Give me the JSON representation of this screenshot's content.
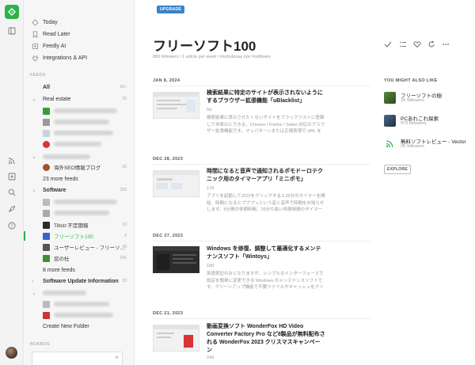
{
  "nav": {
    "top_items": [
      {
        "label": "Today"
      },
      {
        "label": "Read Later"
      },
      {
        "label": "Feedly AI"
      },
      {
        "label": "Integrations & API"
      }
    ],
    "feeds_header": "FEEDS",
    "all": {
      "label": "All",
      "count": "1K+"
    },
    "real_estate": {
      "label": "Real estate",
      "count": "20"
    },
    "seo_feed": {
      "label": "海外SEO情報ブログ",
      "count": "20"
    },
    "more_feeds_1": "23 more feeds",
    "software": {
      "label": "Software",
      "count": "329"
    },
    "tiltstr": {
      "label": "Tiltstr:不定期報",
      "count": "10"
    },
    "freesoft": {
      "label": "フリーソフト100",
      "count": "5"
    },
    "user_review": {
      "label": "ユーザーレビュー - フリーソ…",
      "count": "30"
    },
    "madonomori": {
      "label": "窓の杜",
      "count": "246"
    },
    "more_feeds_2": "8 more feeds",
    "software_update": {
      "label": "Software Update Information",
      "count": "32"
    },
    "create_folder": "Create New Folder",
    "boards_header": "BOARDS"
  },
  "upgrade_label": "UPGRADE",
  "feed": {
    "title": "フリーソフト100",
    "subtitle": "880 followers / 1 article per week / #sohutosaa  #pc  #software"
  },
  "articles": [
    {
      "date": "JAN 8, 2024",
      "title": "検索結果に特定のサイトが表示されないようにするブラウザー拡張機能「uBlacklist」",
      "age": "5d",
      "excerpt": "検索結果に表示させたくないサイトをブラックリストに登録して非表示にできる、Chrome / Firefox / Safari 対応のブラウザー拡張機能です。マッパターンまたは正規表現で URL を指定でき、ウェブサイトのタイトルを…"
    },
    {
      "date": "DEC 28, 2023",
      "title": "時間になると音声で通知されるポモドーロテクニック用のタイマーアプリ「ミニポモ」",
      "age": "17d",
      "excerpt": "アプリを起動して25分をクリックすると25分のタイマーを開始、時間になるとプププっという音と音声で時間をお知らせします。5分間の休憩時間、20分の長い休憩時間のタイマーも用意されており、それぞれクリックする…"
    },
    {
      "date": "DEC 27, 2023",
      "title": "Windows を修復、調整して最適化するメンテナンスソフト「Wintoys」",
      "age": "18d",
      "excerpt": "英語表記のみとなりますが、シンプルなインターフェースで設定を簡単に変更できる Windows のメンテナンスソフトです。クリーンアップ機能で不要ファイルやキャッシュをクリアして PC の空き容量を確保不要なサービス…"
    },
    {
      "date": "DEC 21, 2023",
      "title": "動画変換ソフト WonderFox HD Video Converter Factory Pro など8製品が無料配布される WonderFox 2023 クリスマスキャンペーン",
      "age": "24d",
      "excerpt": ""
    }
  ],
  "sidebar_right": {
    "header": "YOU MIGHT ALSO LIKE",
    "recs": [
      {
        "name": "フリーソフトの樹",
        "followers": "1K followers"
      },
      {
        "name": "PCあれこれ探索",
        "followers": "973 followers"
      },
      {
        "name": "無料ソフトレビュー - Vector",
        "followers": "2K followers"
      }
    ],
    "explore_label": "EXPLORE"
  },
  "colors": {
    "brand_green": "#2bb24c",
    "upgrade_blue": "#3b82c8"
  }
}
